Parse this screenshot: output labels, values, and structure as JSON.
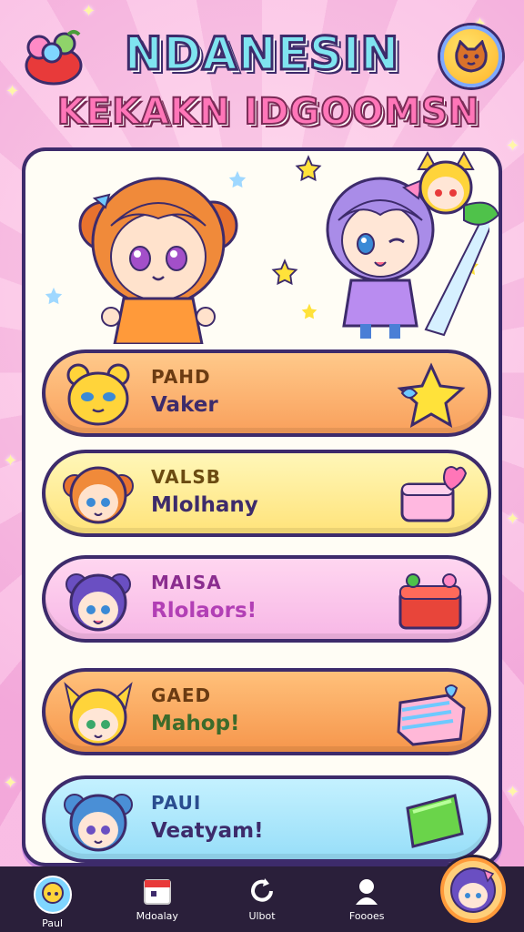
{
  "header": {
    "title_line1": "NDANESIN",
    "title_line2": "KEKAKN IDGOOMSN",
    "logo_icon": "fruit-basket-icon",
    "settings_icon": "cat-face-icon"
  },
  "entries": [
    {
      "name": "PAHD",
      "status": "Vaker",
      "avatar": "bear-face-icon",
      "item": "star-icon"
    },
    {
      "name": "VALSB",
      "status": "Mlolhany",
      "avatar": "girl-orange-hair-avatar",
      "item": "gift-box-icon"
    },
    {
      "name": "MAISA",
      "status": "Rlolaors!",
      "avatar": "girl-purple-hair-avatar",
      "item": "cake-box-icon"
    },
    {
      "name": "GAED",
      "status": "Mahop!",
      "avatar": "fox-girl-avatar",
      "item": "candy-box-icon"
    },
    {
      "name": "PAUI",
      "status": "Veatyam!",
      "avatar": "girl-blue-hair-avatar",
      "item": "green-gem-icon"
    }
  ],
  "nav": [
    {
      "label": "Paul",
      "icon": "avatar-icon"
    },
    {
      "label": "Mdoalay",
      "icon": "calendar-icon"
    },
    {
      "label": "Ulbot",
      "icon": "refresh-icon"
    },
    {
      "label": "Foooes",
      "icon": "friends-icon"
    }
  ],
  "colors": {
    "background_pink": "#f7a8d3",
    "card_bg": "#fffdf5",
    "outline": "#3d2b6b",
    "nav_bg": "#2a1f3a"
  }
}
